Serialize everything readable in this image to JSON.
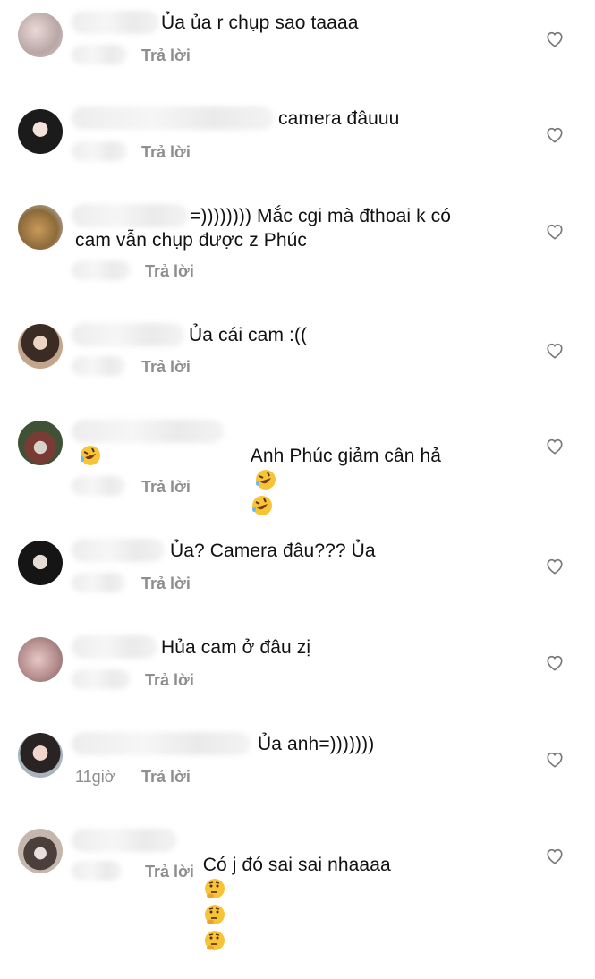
{
  "comments": [
    {
      "text": "Ủa ủa r chụp sao taaaa",
      "reply": "Trả lời",
      "time": ""
    },
    {
      "text": "camera đâuuu",
      "reply": "Trả lời",
      "time": ""
    },
    {
      "text": "=)))))))) Mắc cgi mà đthoai k có",
      "text2": "cam vẫn chụp được z Phúc",
      "reply": "Trả lời",
      "time": ""
    },
    {
      "text": "Ủa cái cam :((",
      "reply": "Trả lời",
      "time": ""
    },
    {
      "text": "Anh Phúc giảm cân hả",
      "reply": "Trả lời",
      "time": ""
    },
    {
      "text": "Ủa? Camera đâu??? Ủa",
      "reply": "Trả lời",
      "time": ""
    },
    {
      "text": "Hủa cam ở đâu zị",
      "reply": "Trả lời",
      "time": ""
    },
    {
      "text": "Ủa anh=)))))))",
      "reply": "Trả lời",
      "time": "11giờ"
    },
    {
      "text": "Có j đó sai sai nhaaaa",
      "reply": "Trả lời",
      "time": ""
    }
  ],
  "icons": {
    "like": "heart-outline-icon",
    "laugh": "rolling-on-floor-laughing-emoji",
    "thinking": "thinking-face-emoji"
  },
  "colors": {
    "text": "#111111",
    "meta": "#8e8e8e",
    "heart": "#777777"
  }
}
